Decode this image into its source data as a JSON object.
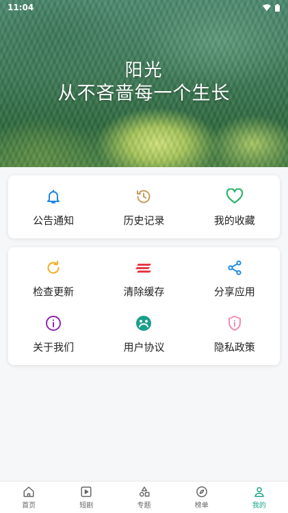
{
  "status": {
    "time": "11:04"
  },
  "hero": {
    "line1": "阳光",
    "line2": "从不吝啬每一个生长"
  },
  "menu_top": [
    {
      "label": "公告通知",
      "icon": "bell-icon",
      "color": "#1e88e5"
    },
    {
      "label": "历史记录",
      "icon": "history-icon",
      "color": "#c99a5b"
    },
    {
      "label": "我的收藏",
      "icon": "heart-icon",
      "color": "#2db36b"
    }
  ],
  "menu_bottom": [
    {
      "label": "检查更新",
      "icon": "refresh-icon",
      "color": "#f2b233"
    },
    {
      "label": "清除缓存",
      "icon": "clear-icon",
      "color": "#e53946"
    },
    {
      "label": "分享应用",
      "icon": "share-icon",
      "color": "#1e88e5"
    },
    {
      "label": "关于我们",
      "icon": "info-icon",
      "color": "#8e24aa"
    },
    {
      "label": "用户协议",
      "icon": "agreement-icon",
      "color": "#1a9e8c"
    },
    {
      "label": "隐私政策",
      "icon": "shield-icon",
      "color": "#f08ab0"
    }
  ],
  "tabs": [
    {
      "label": "首页",
      "icon": "home-icon"
    },
    {
      "label": "短剧",
      "icon": "video-icon"
    },
    {
      "label": "专题",
      "icon": "category-icon"
    },
    {
      "label": "榜单",
      "icon": "compass-icon"
    },
    {
      "label": "我的",
      "icon": "user-icon",
      "active": true
    }
  ],
  "colors": {
    "accent": "#19a389",
    "background": "#f6f7f8"
  }
}
